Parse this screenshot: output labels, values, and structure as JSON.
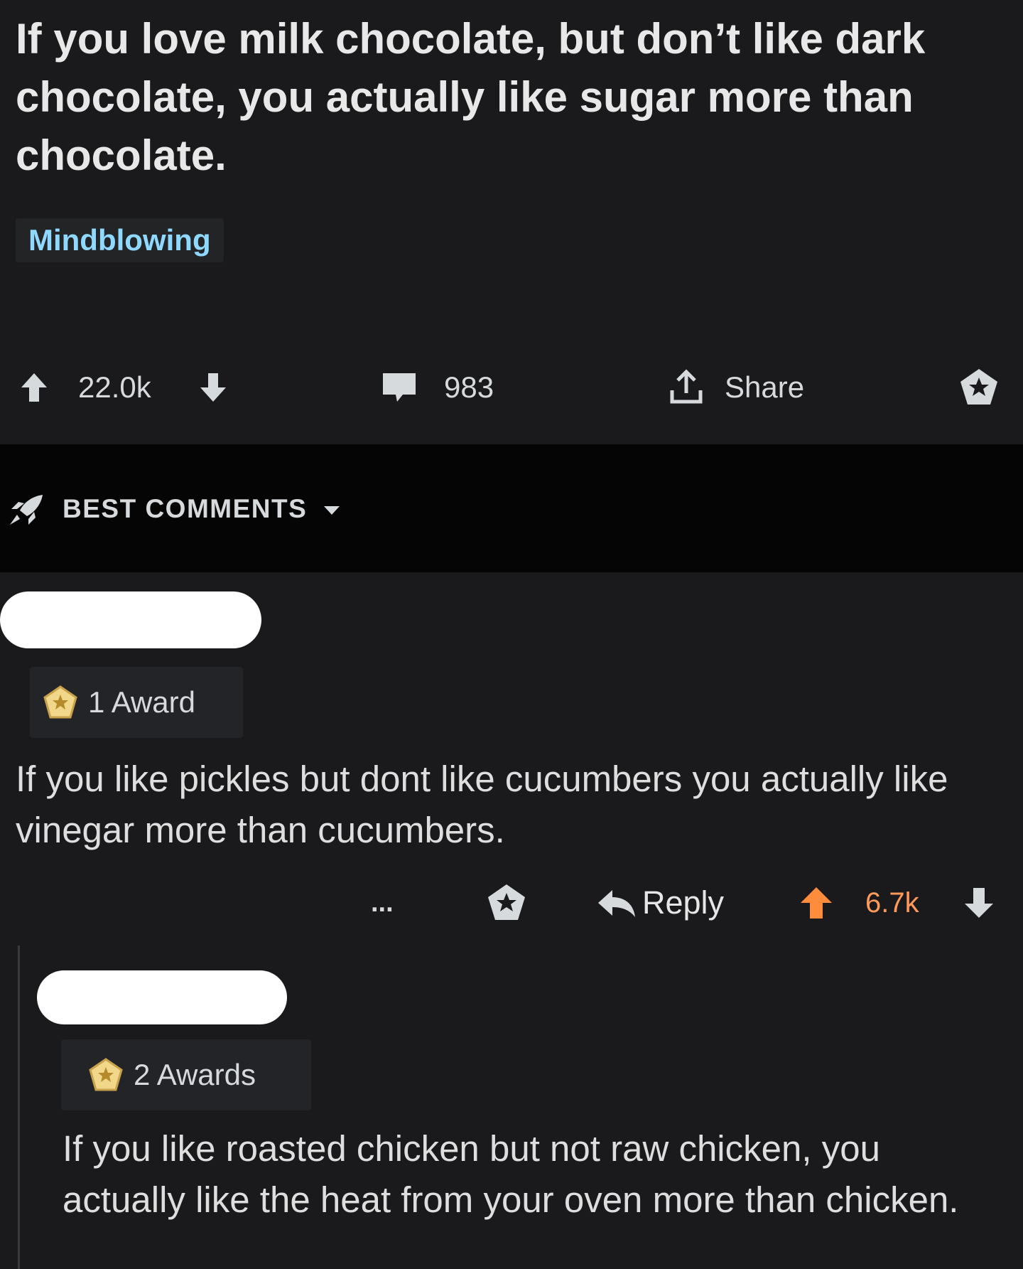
{
  "post": {
    "title": "If you love milk chocolate, but don’t like dark chocolate, you actually like sugar more than chocolate.",
    "flair": "Mindblowing",
    "score": "22.0k",
    "comments": "983",
    "share_label": "Share"
  },
  "sort": {
    "label": "BEST COMMENTS"
  },
  "comments": [
    {
      "awards": "1 Award",
      "body": "If you like pickles but dont like cucumbers you actually like vinegar more than cucumbers.",
      "more": "...",
      "reply_label": "Reply",
      "score": "6.7k"
    },
    {
      "awards": "2 Awards",
      "body": "If you like roasted chicken but not raw chicken, you actually like the heat from your oven more than chicken."
    }
  ],
  "colors": {
    "background": "#1a1a1c",
    "flair_text": "#8fd8ff",
    "upvote_active": "#ff8b3d",
    "score_active": "#ff9a5a"
  }
}
